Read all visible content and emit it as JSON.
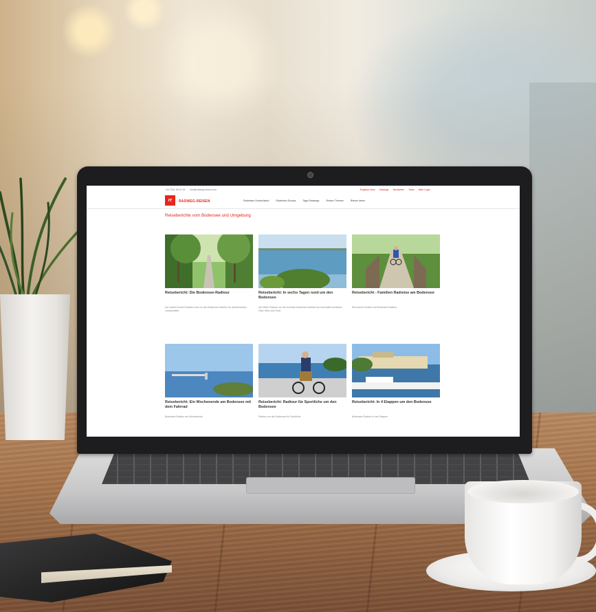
{
  "site": {
    "topbar": {
      "phone": "+49 7531 36 43 18",
      "email": "info@radweg-reisen.com",
      "links": [
        "Englisch Infos",
        "Kataloge",
        "Newsletter",
        "Team",
        "Mein Login"
      ]
    },
    "logo": {
      "mark": "rr",
      "name": "RADWEG-REISEN"
    },
    "nav": [
      "Radreisen Deutschland",
      "Radreisen Europa",
      "Tage-Radwege",
      "Reisen Themen",
      "Reisen Ideen"
    ],
    "heading": "Reiseberichte vom Bodensee und Umgebung",
    "cards": [
      {
        "title": "Reisebericht: Die Bodensee-Radtour",
        "text": "Auf unserer letzten Radtour rund um den Bodensee erlebten wir wunderschöne Landschaften"
      },
      {
        "title": "Reisebericht: In sechs Tagen rund um den Bodensee",
        "text": "Auf dieser Radtour um den schönen Bodensee erlebten wir traumhafte Ausblicke, Obst, Wein und Ruhe"
      },
      {
        "title": "Reisebericht - Familien Radreise am Bodensee",
        "text": "Mit unseren Kindern auf Bodensee-Radtour"
      },
      {
        "title": "Reisebericht: Ein Wochenende am Bodensee mit dem Fahrrad",
        "text": "Bodensee-Radtour am Wochenende"
      },
      {
        "title": "Reisebericht: Radtour für Sportliche um den Bodensee",
        "text": "Radtour um den Bodensee für Sportliche"
      },
      {
        "title": "Reisebericht: In 4 Etappen um den Bodensee",
        "text": "Bodensee-Radtour in vier Etappen"
      }
    ]
  },
  "colors": {
    "brand_red": "#e5261c",
    "text_dark": "#333333",
    "text_muted": "#888888"
  }
}
